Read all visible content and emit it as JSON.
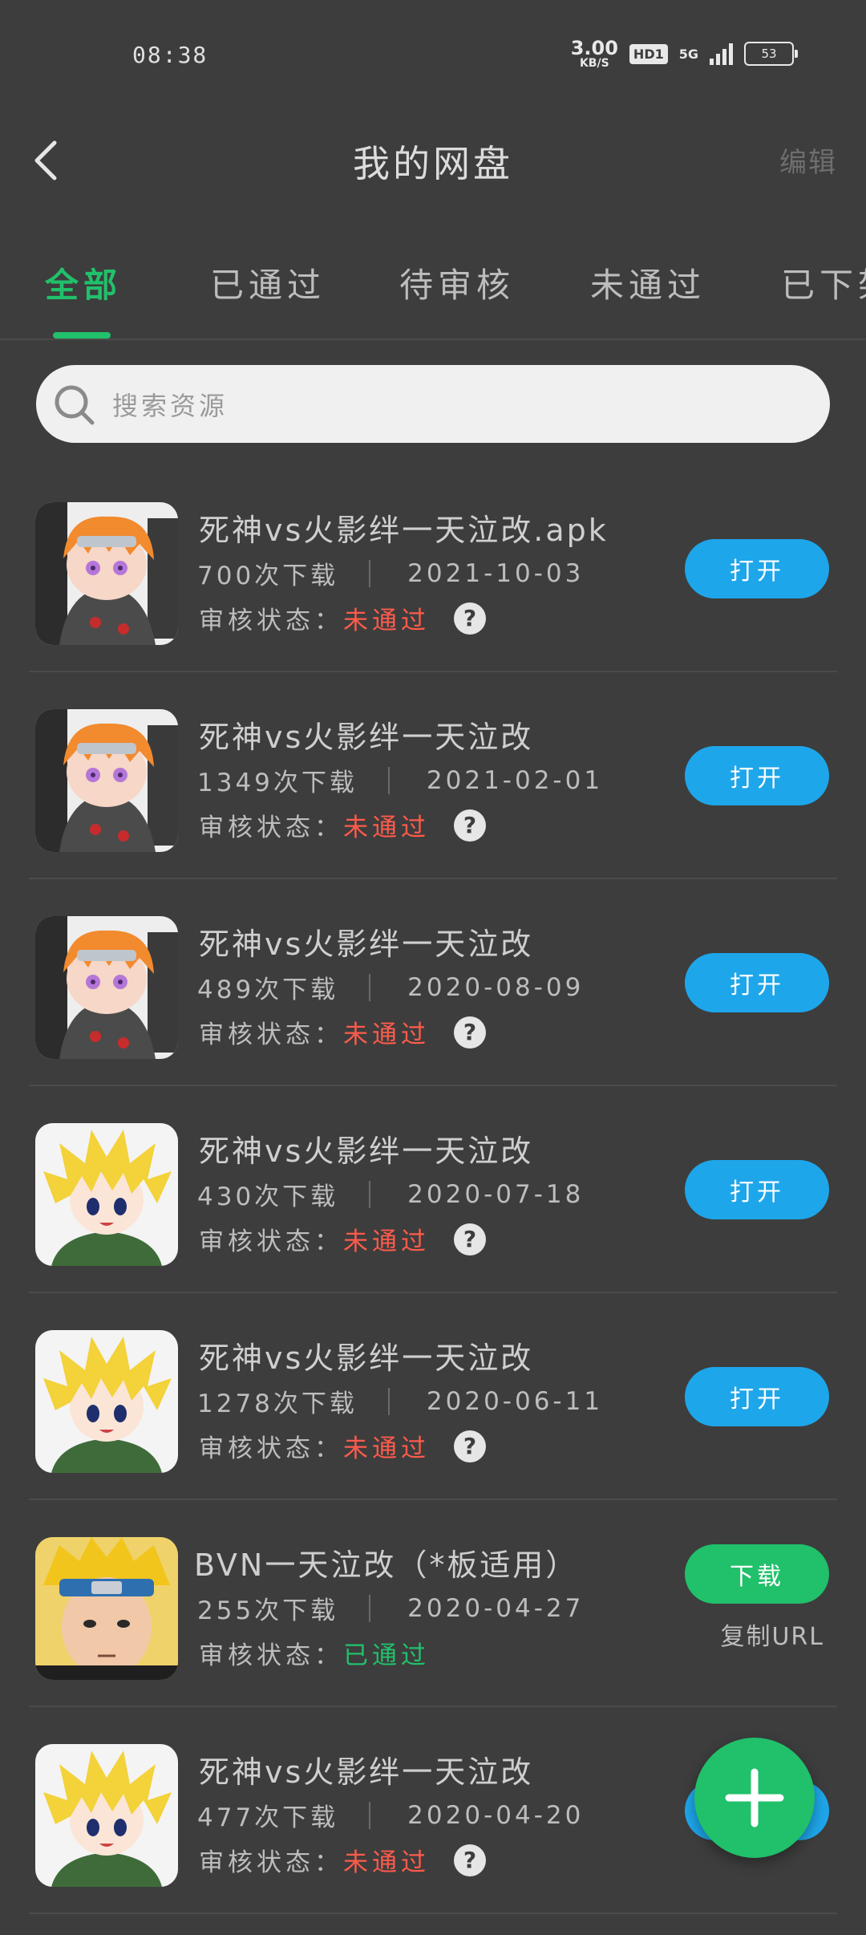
{
  "status_bar": {
    "time": "08:38",
    "speed_value": "3.00",
    "speed_unit": "KB/S",
    "hd": "HD1",
    "network": "5G",
    "battery": "53"
  },
  "header": {
    "title": "我的网盘",
    "edit": "编辑"
  },
  "tabs": [
    {
      "label": "全部",
      "active": true
    },
    {
      "label": "已通过",
      "active": false
    },
    {
      "label": "待审核",
      "active": false
    },
    {
      "label": "未通过",
      "active": false
    },
    {
      "label": "已下架",
      "active": false
    }
  ],
  "search": {
    "placeholder": "搜索资源"
  },
  "items": [
    {
      "name": "死神vs火影绊一天泣改.apk",
      "downloads": "700次下载",
      "date": "2021-10-03",
      "status_label": "审核状态：",
      "status": "未通过",
      "action": "打开",
      "avatar": "pain"
    },
    {
      "name": "死神vs火影绊一天泣改",
      "downloads": "1349次下载",
      "date": "2021-02-01",
      "status_label": "审核状态：",
      "status": "未通过",
      "action": "打开",
      "avatar": "pain"
    },
    {
      "name": "死神vs火影绊一天泣改",
      "downloads": "489次下载",
      "date": "2020-08-09",
      "status_label": "审核状态：",
      "status": "未通过",
      "action": "打开",
      "avatar": "pain"
    },
    {
      "name": "死神vs火影绊一天泣改",
      "downloads": "430次下载",
      "date": "2020-07-18",
      "status_label": "审核状态：",
      "status": "未通过",
      "action": "打开",
      "avatar": "minato"
    },
    {
      "name": "死神vs火影绊一天泣改",
      "downloads": "1278次下载",
      "date": "2020-06-11",
      "status_label": "审核状态：",
      "status": "未通过",
      "action": "打开",
      "avatar": "minato"
    },
    {
      "name": "BVN一天泣改（*板适用）",
      "downloads": "255次下载",
      "date": "2020-04-27",
      "status_label": "审核状态：",
      "status": "已通过",
      "action": "下载",
      "secondary": "复制URL",
      "avatar": "naruto"
    },
    {
      "name": "死神vs火影绊一天泣改",
      "downloads": "477次下载",
      "date": "2020-04-20",
      "status_label": "审核状态：",
      "status": "未通过",
      "action": "打开",
      "avatar": "minato"
    }
  ],
  "colors": {
    "accent_green": "#21c06b",
    "button_blue": "#1ea6ea",
    "fail_red": "#ff5b4b",
    "background": "#3d3d3d"
  },
  "icons": {
    "back": "chevron-left-icon",
    "search": "search-icon",
    "help": "question-icon",
    "fab": "plus-icon"
  }
}
